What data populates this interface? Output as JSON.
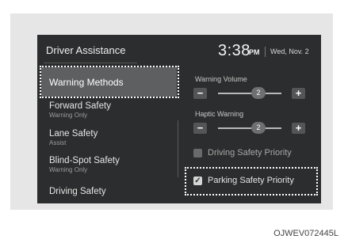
{
  "header": {
    "title": "Driver Assistance",
    "time": "3:38",
    "ampm": "PM",
    "date": "Wed, Nov. 2"
  },
  "menu": {
    "selected": "Warning Methods",
    "items": [
      {
        "label": "Forward Safety",
        "sub": "Warning Only"
      },
      {
        "label": "Lane Safety",
        "sub": "Assist"
      },
      {
        "label": "Blind-Spot Safety",
        "sub": "Warning Only"
      },
      {
        "label": "Driving Safety",
        "sub": ""
      }
    ]
  },
  "settings": {
    "warning_volume": {
      "label": "Warning Volume",
      "value": "2",
      "minus": "−",
      "plus": "+"
    },
    "haptic_warning": {
      "label": "Haptic Warning",
      "value": "2",
      "minus": "−",
      "plus": "+"
    },
    "driving_safety_priority": {
      "label": "Driving Safety Priority",
      "checked": false
    },
    "parking_safety_priority": {
      "label": "Parking Safety Priority",
      "checked": true,
      "check_glyph": "✓"
    }
  },
  "caption": "OJWEV072445L"
}
